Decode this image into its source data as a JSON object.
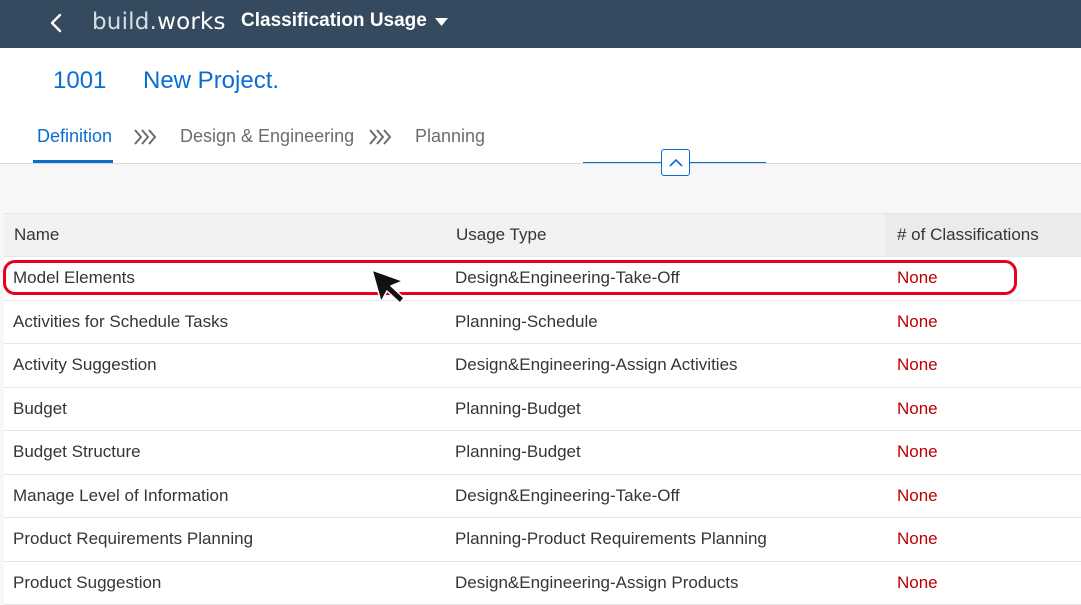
{
  "shell": {
    "logo_light": "build.",
    "logo_strong": "works",
    "app_title": "Classification Usage"
  },
  "project": {
    "id": "1001",
    "name": "New Project."
  },
  "tabs": [
    {
      "label": "Definition"
    },
    {
      "label": "Design & Engineering"
    },
    {
      "label": "Planning"
    }
  ],
  "table": {
    "columns": [
      "Name",
      "Usage Type",
      "# of Classifications"
    ],
    "rows": [
      {
        "name": "Model Elements",
        "usage": "Design&Engineering-Take-Off",
        "count": "None"
      },
      {
        "name": "Activities for Schedule Tasks",
        "usage": "Planning-Schedule",
        "count": "None"
      },
      {
        "name": "Activity Suggestion",
        "usage": "Design&Engineering-Assign Activities",
        "count": "None"
      },
      {
        "name": "Budget",
        "usage": "Planning-Budget",
        "count": "None"
      },
      {
        "name": "Budget Structure",
        "usage": "Planning-Budget",
        "count": "None"
      },
      {
        "name": "Manage Level of Information",
        "usage": "Design&Engineering-Take-Off",
        "count": "None"
      },
      {
        "name": "Product Requirements Planning",
        "usage": "Planning-Product Requirements Planning",
        "count": "None"
      },
      {
        "name": "Product Suggestion",
        "usage": "Design&Engineering-Assign Products",
        "count": "None"
      }
    ]
  },
  "colors": {
    "shellbar": "#354a5f",
    "accent": "#0a6ed1",
    "none_status": "#bb0000",
    "highlight": "#e8001c"
  }
}
